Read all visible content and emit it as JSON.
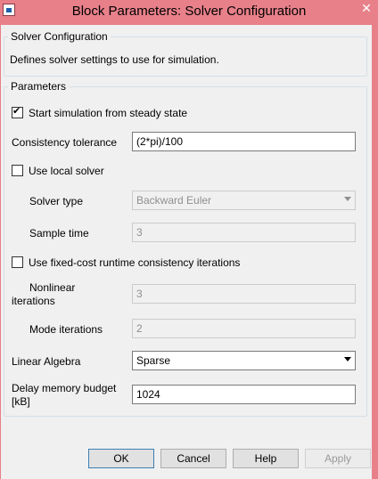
{
  "window": {
    "title": "Block Parameters: Solver Configuration",
    "close_glyph": "✕",
    "icon": "simulink-block-icon"
  },
  "description_group": {
    "title": "Solver Configuration",
    "text": "Defines solver settings to use for simulation."
  },
  "parameters": {
    "title": "Parameters",
    "steady_state": {
      "label": "Start simulation from steady state",
      "checked": true
    },
    "consistency_tolerance": {
      "label": "Consistency tolerance",
      "value": "(2*pi)/100"
    },
    "local_solver": {
      "label": "Use local solver",
      "checked": false
    },
    "solver_type": {
      "label": "Solver type",
      "value": "Backward Euler",
      "enabled": false
    },
    "sample_time": {
      "label": "Sample time",
      "value": "3",
      "enabled": false
    },
    "fixed_cost": {
      "label": "Use fixed-cost runtime consistency iterations",
      "checked": false
    },
    "nonlinear_iterations": {
      "label_line1": "Nonlinear",
      "label_line2": "iterations",
      "value": "3",
      "enabled": false
    },
    "mode_iterations": {
      "label": "Mode iterations",
      "value": "2",
      "enabled": false
    },
    "linear_algebra": {
      "label": "Linear Algebra",
      "value": "Sparse"
    },
    "delay_memory": {
      "label_line1": "Delay memory budget",
      "label_line2": "[kB]",
      "value": "1024"
    }
  },
  "buttons": {
    "ok": "OK",
    "cancel": "Cancel",
    "help": "Help",
    "apply": "Apply"
  }
}
